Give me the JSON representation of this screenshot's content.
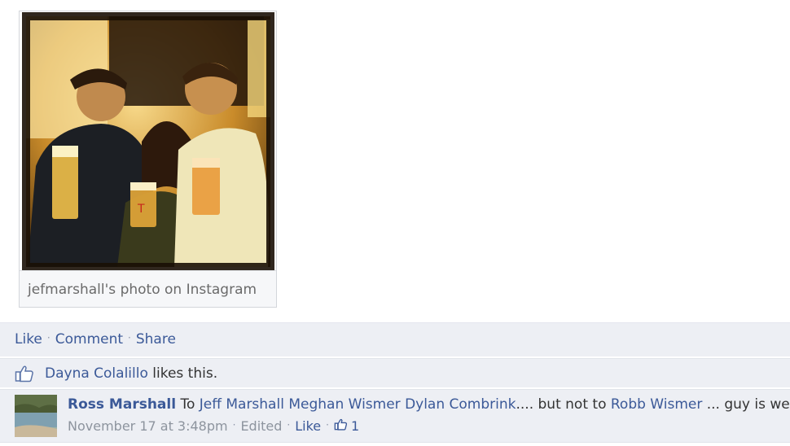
{
  "photo": {
    "caption": "jefmarshall's photo on Instagram"
  },
  "actions": {
    "like": "Like",
    "comment": "Comment",
    "share": "Share"
  },
  "likes": {
    "name": "Dayna Colalillo",
    "suffix": "likes this."
  },
  "comment": {
    "author": "Ross Marshall",
    "prefix": "To",
    "tagged": [
      "Jeff Marshall",
      "Meghan Wismer",
      "Dylan Combrink"
    ],
    "middle": ".... but not to",
    "excluded": "Robb Wismer",
    "tail": "... guy is weak",
    "timestamp": "November 17 at 3:48pm",
    "edited": "Edited",
    "like_label": "Like",
    "like_count": "1"
  },
  "icons": {
    "like_thumb": "thumbs-up-icon",
    "small_thumb": "thumbs-up-icon"
  },
  "colors": {
    "link": "#3b5998",
    "ufi_background": "#edeff4",
    "meta_text": "#8d949e"
  }
}
